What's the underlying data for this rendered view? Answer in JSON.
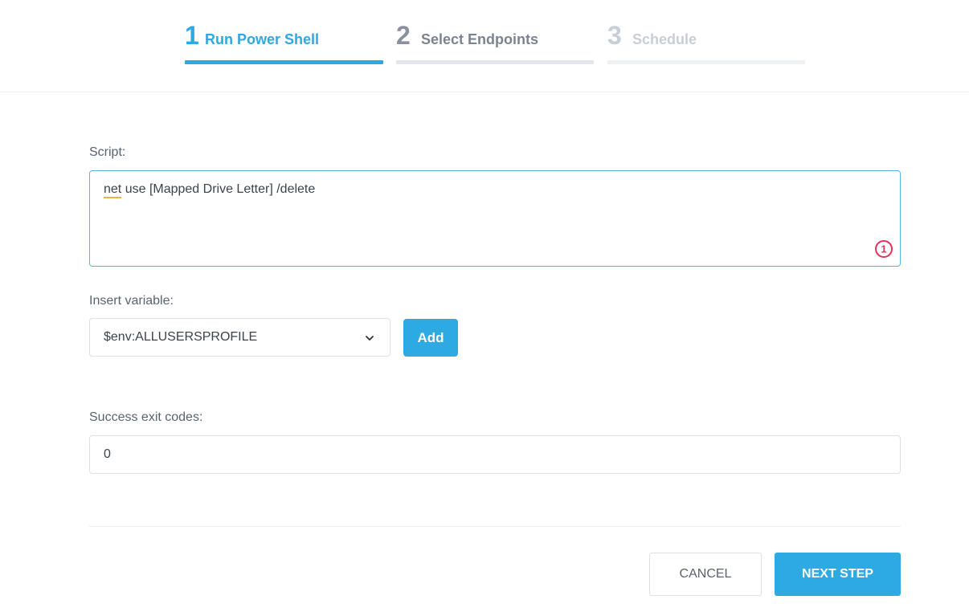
{
  "stepper": {
    "steps": [
      {
        "number": "1",
        "label": "Run Power Shell",
        "state": "active"
      },
      {
        "number": "2",
        "label": "Select Endpoints",
        "state": "upcoming"
      },
      {
        "number": "3",
        "label": "Schedule",
        "state": "disabled"
      }
    ]
  },
  "script": {
    "label": "Script:",
    "value_first_word": "net",
    "value_rest": " use [Mapped Drive Letter] /delete",
    "issue_count": "1",
    "issue_icon": "warning-count-icon"
  },
  "insert_variable": {
    "label": "Insert variable:",
    "selected": "$env:ALLUSERSPROFILE",
    "add_label": "Add"
  },
  "exit_codes": {
    "label": "Success exit codes:",
    "value": "0"
  },
  "footer": {
    "cancel_label": "CANCEL",
    "next_label": "NEXT STEP"
  },
  "colors": {
    "accent": "#2eaae3",
    "warning": "#e8305a",
    "spellcheck": "#e9b24a"
  }
}
